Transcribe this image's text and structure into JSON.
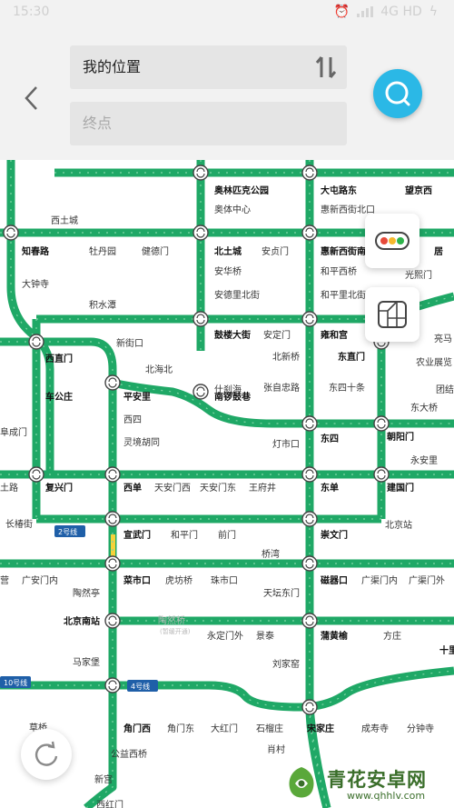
{
  "status_bar": {
    "time": "15:30",
    "network": "4G HD"
  },
  "search": {
    "from_value": "我的位置",
    "to_placeholder": "终点"
  },
  "stations": [
    {
      "name": "奥林匹克公园",
      "bold": true
    },
    {
      "name": "大屯路东",
      "bold": true
    },
    {
      "name": "望京西",
      "bold": true
    },
    {
      "name": "奥体中心",
      "bold": false
    },
    {
      "name": "惠新西街北口",
      "bold": false
    },
    {
      "name": "西土城",
      "bold": false
    },
    {
      "name": "知春路",
      "bold": true
    },
    {
      "name": "牡丹园",
      "bold": false
    },
    {
      "name": "健德门",
      "bold": false
    },
    {
      "name": "北土城",
      "bold": true
    },
    {
      "name": "安贞门",
      "bold": false
    },
    {
      "name": "惠新西街南口",
      "bold": true
    },
    {
      "name": "居",
      "bold": true
    },
    {
      "name": "安华桥",
      "bold": false
    },
    {
      "name": "和平西桥",
      "bold": false
    },
    {
      "name": "光熙门",
      "bold": false
    },
    {
      "name": "大钟寺",
      "bold": false
    },
    {
      "name": "安德里北街",
      "bold": false
    },
    {
      "name": "和平里北街",
      "bold": false
    },
    {
      "name": "积水潭",
      "bold": false
    },
    {
      "name": "鼓楼大街",
      "bold": true
    },
    {
      "name": "安定门",
      "bold": false
    },
    {
      "name": "雍和宫",
      "bold": true
    },
    {
      "name": "亮马",
      "bold": false
    },
    {
      "name": "新街口",
      "bold": false
    },
    {
      "name": "西直门",
      "bold": true
    },
    {
      "name": "北新桥",
      "bold": false
    },
    {
      "name": "东直门",
      "bold": true
    },
    {
      "name": "农业展览",
      "bold": false
    },
    {
      "name": "北海北",
      "bold": false
    },
    {
      "name": "什刹海",
      "bold": false
    },
    {
      "name": "团结",
      "bold": false
    },
    {
      "name": "车公庄",
      "bold": true
    },
    {
      "name": "平安里",
      "bold": true
    },
    {
      "name": "南锣鼓巷",
      "bold": true
    },
    {
      "name": "张自忠路",
      "bold": false
    },
    {
      "name": "东四十条",
      "bold": false
    },
    {
      "name": "东大桥",
      "bold": false
    },
    {
      "name": "西四",
      "bold": false
    },
    {
      "name": "阜成门",
      "bold": false
    },
    {
      "name": "灵境胡同",
      "bold": false
    },
    {
      "name": "灯市口",
      "bold": false
    },
    {
      "name": "东四",
      "bold": true
    },
    {
      "name": "朝阳门",
      "bold": true
    },
    {
      "name": "永安里",
      "bold": false
    },
    {
      "name": "土路",
      "bold": false
    },
    {
      "name": "复兴门",
      "bold": true
    },
    {
      "name": "西单",
      "bold": true
    },
    {
      "name": "天安门西",
      "bold": false
    },
    {
      "name": "天安门东",
      "bold": false
    },
    {
      "name": "王府井",
      "bold": false
    },
    {
      "name": "东单",
      "bold": true
    },
    {
      "name": "建国门",
      "bold": true
    },
    {
      "name": "长椿街",
      "bold": false
    },
    {
      "name": "宣武门",
      "bold": true
    },
    {
      "name": "和平门",
      "bold": false
    },
    {
      "name": "前门",
      "bold": false
    },
    {
      "name": "崇文门",
      "bold": true
    },
    {
      "name": "北京站",
      "bold": false
    },
    {
      "name": "桥湾",
      "bold": false
    },
    {
      "name": "营",
      "bold": false
    },
    {
      "name": "广安门内",
      "bold": false
    },
    {
      "name": "菜市口",
      "bold": true
    },
    {
      "name": "虎坊桥",
      "bold": false
    },
    {
      "name": "珠市口",
      "bold": false
    },
    {
      "name": "磁器口",
      "bold": true
    },
    {
      "name": "广渠门内",
      "bold": false
    },
    {
      "name": "广渠门外",
      "bold": false
    },
    {
      "name": "陶然亭",
      "bold": false
    },
    {
      "name": "天坛东门",
      "bold": false
    },
    {
      "name": "北京南站",
      "bold": true
    },
    {
      "name": "陶然桥",
      "bold": false,
      "grey": true
    },
    {
      "name": "永定门外",
      "bold": false
    },
    {
      "name": "景泰",
      "bold": false
    },
    {
      "name": "蒲黄榆",
      "bold": true
    },
    {
      "name": "方庄",
      "bold": false
    },
    {
      "name": "十里",
      "bold": true
    },
    {
      "name": "马家堡",
      "bold": false
    },
    {
      "name": "刘家窑",
      "bold": false
    },
    {
      "name": "草桥",
      "bold": false
    },
    {
      "name": "角门西",
      "bold": true
    },
    {
      "name": "角门东",
      "bold": false
    },
    {
      "name": "大红门",
      "bold": false
    },
    {
      "name": "石榴庄",
      "bold": false
    },
    {
      "name": "宋家庄",
      "bold": true
    },
    {
      "name": "成寿寺",
      "bold": false
    },
    {
      "name": "分钟寺",
      "bold": false
    },
    {
      "name": "公益西桥",
      "bold": false
    },
    {
      "name": "肖村",
      "bold": false
    },
    {
      "name": "新宫",
      "bold": false
    },
    {
      "name": "西红门",
      "bold": false
    }
  ],
  "note_tao_ran_qiao": "(暂缓开通)",
  "line_tags": [
    "2号线",
    "4号线",
    "10号线"
  ],
  "watermark": {
    "title": "青花安卓网",
    "url": "www.qhhlv.com"
  },
  "colors": {
    "line": "#1fa866",
    "line_light": "#7fd6a6",
    "accent": "#2bb8e6",
    "tag": "#1f5fa8",
    "yellow": "#f5d23a"
  }
}
